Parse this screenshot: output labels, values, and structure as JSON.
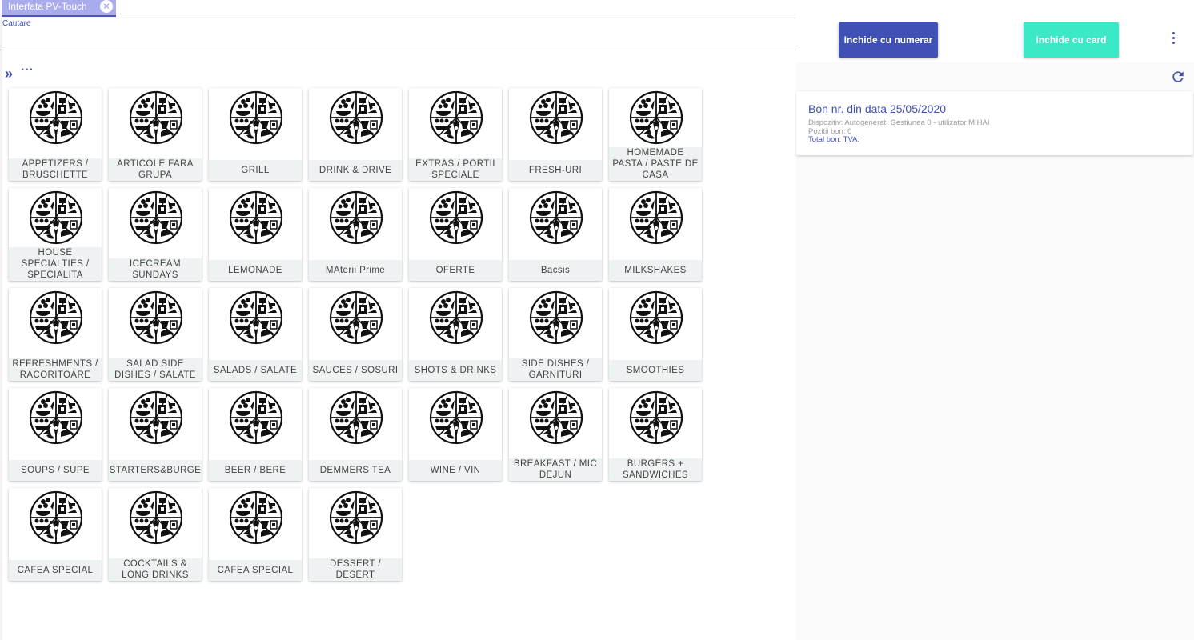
{
  "tab": {
    "title": "Interfata PV-Touch",
    "close": "×"
  },
  "search": {
    "label": "Cautare",
    "placeholder": ""
  },
  "breadcrumb": {
    "expand": "»",
    "more": "···"
  },
  "actions": {
    "close_cash": "Inchide cu numerar",
    "close_card": "Inchide cu card",
    "colors": {
      "cash": "#3f51b5",
      "card": "#3be8c7"
    }
  },
  "receipt": {
    "title": "Bon nr. din data 25/05/2020",
    "device": "Dispozitiv: Autogenerat: Gestiunea 0 - utilizator MIHAI",
    "positions": "Pozitii bon: 0",
    "total": "Total bon:  TVA:"
  },
  "categories": [
    "APPETIZERS / BRUSCHETTE",
    "ARTICOLE FARA GRUPA",
    "GRILL",
    "DRINK & DRIVE",
    "EXTRAS / PORTII SPECIALE",
    "FRESH-URI",
    "HOMEMADE PASTA / PASTE DE CASA",
    "HOUSE SPECIALTIES / SPECIALITA",
    "ICECREAM SUNDAYS",
    "LEMONADE",
    "MAterii Prime",
    "OFERTE",
    "Bacsis",
    "MILKSHAKES",
    "REFRESHMENTS / RACORITOARE",
    "SALAD SIDE DISHES / SALATE",
    "SALADS / SALATE",
    "SAUCES / SOSURI",
    "SHOTS & DRINKS",
    "SIDE DISHES / GARNITURI",
    "SMOOTHIES",
    "SOUPS / SUPE",
    "STARTERS&BURGE",
    "BEER / BERE",
    "DEMMERS TEA",
    "WINE / VIN",
    "BREAKFAST / MIC DEJUN",
    "BURGERS + SANDWICHES",
    "CAFEA SPECIAL",
    "COCKTAILS & LONG DRINKS",
    "CAFEA SPECIAL",
    "DESSERT / DESERT"
  ]
}
